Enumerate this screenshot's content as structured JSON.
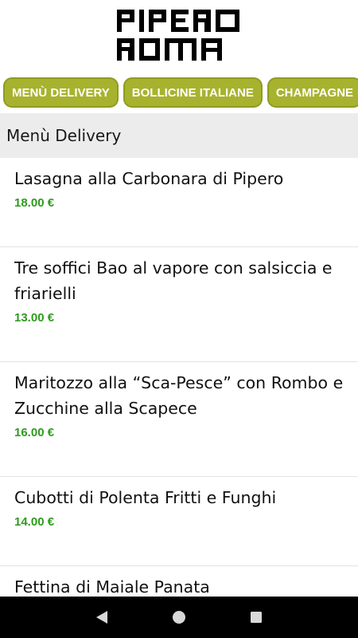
{
  "header": {
    "logo_alt": "PIPERO ROMA"
  },
  "tabs": [
    {
      "label": "MENÙ DELIVERY"
    },
    {
      "label": "BOLLICINE ITALIANE"
    },
    {
      "label": "CHAMPAGNE"
    },
    {
      "label": ""
    }
  ],
  "section": {
    "title": "Menù Delivery"
  },
  "items": [
    {
      "name": "Lasagna alla Carbonara di Pipero",
      "price": "18.00 €"
    },
    {
      "name": "Tre soffici Bao al vapore con salsiccia e friarielli",
      "price": "13.00 €"
    },
    {
      "name": "Maritozzo alla “Sca-Pesce” con Rombo e Zucchine alla Scapece",
      "price": "16.00 €"
    },
    {
      "name": "Cubotti di Polenta Fritti e Funghi",
      "price": "14.00 €"
    },
    {
      "name": "Fettina di Maiale Panata",
      "price": ""
    }
  ],
  "colors": {
    "tab_bg": "#a7b32e",
    "price": "#2e9b1e",
    "section_bg": "#ececec"
  },
  "navbar": {
    "back_icon": "back-triangle-icon",
    "home_icon": "home-circle-icon",
    "recents_icon": "recents-square-icon"
  }
}
